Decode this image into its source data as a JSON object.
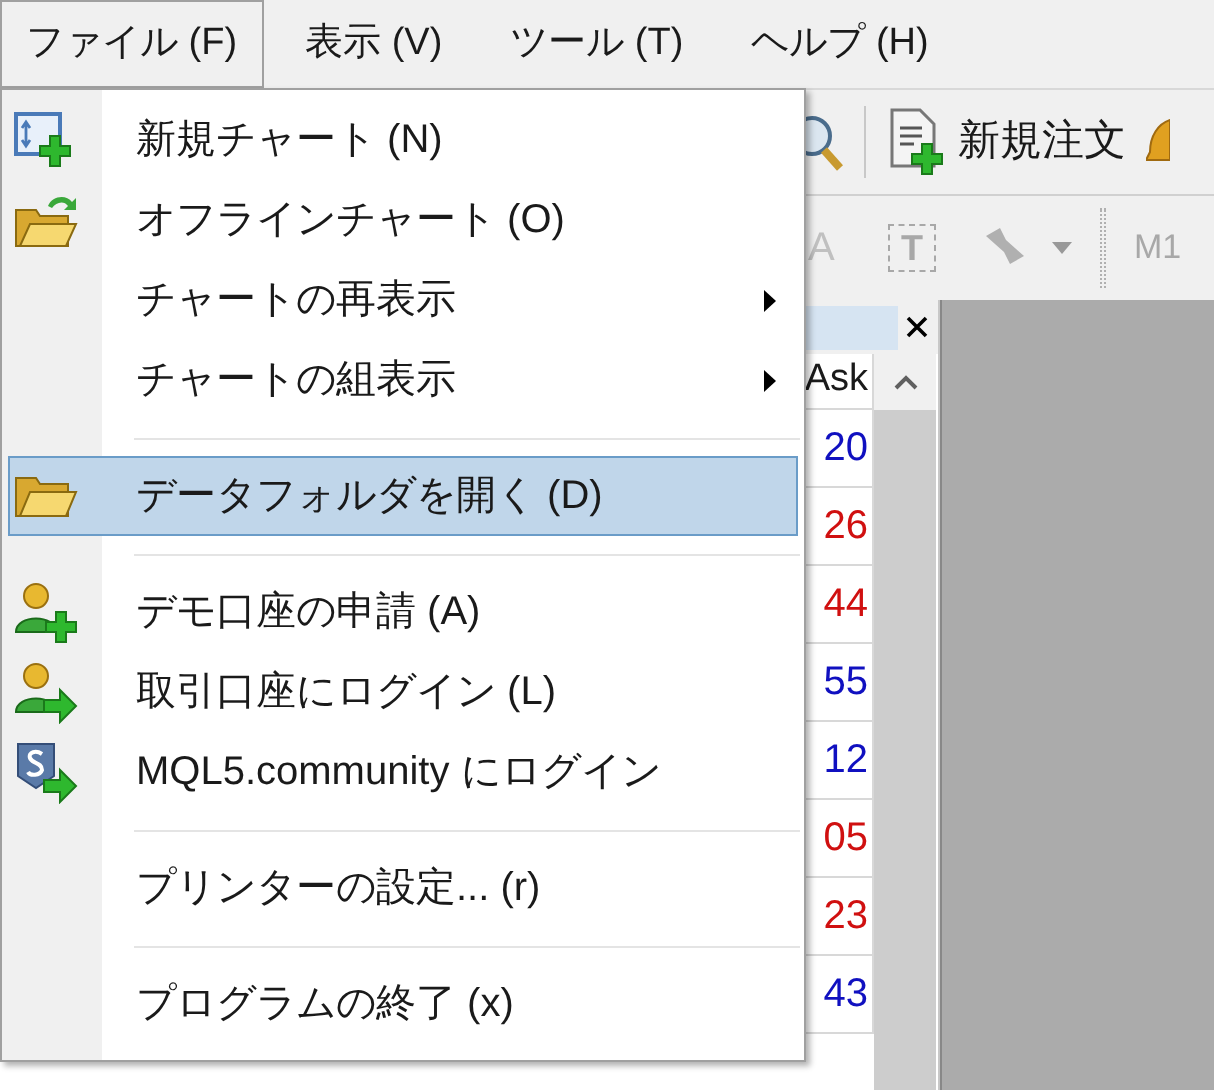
{
  "menubar": [
    {
      "label": "ファイル (F)",
      "selected": true
    },
    {
      "label": "表示 (V)",
      "selected": false
    },
    {
      "label": "ツール (T)",
      "selected": false
    },
    {
      "label": "ヘルプ (H)",
      "selected": false
    }
  ],
  "toolbar": {
    "new_order": "新規注文",
    "font_tool": "A",
    "text_tool": "T",
    "timeframe": "M1"
  },
  "market_watch": {
    "column": "Ask",
    "rows": [
      {
        "value": "20",
        "color": "#1010c0"
      },
      {
        "value": "26",
        "color": "#d01010"
      },
      {
        "value": "44",
        "color": "#d01010"
      },
      {
        "value": "55",
        "color": "#1010c0"
      },
      {
        "value": "12",
        "color": "#1010c0"
      },
      {
        "value": "05",
        "color": "#d01010"
      },
      {
        "value": "23",
        "color": "#d01010"
      },
      {
        "value": "43",
        "color": "#1010c0"
      }
    ]
  },
  "file_menu": [
    {
      "kind": "item",
      "label": "新規チャート (N)",
      "selected": false,
      "submenu": false
    },
    {
      "kind": "item",
      "label": "オフラインチャート (O)",
      "selected": false,
      "submenu": false
    },
    {
      "kind": "item",
      "label": "チャートの再表示",
      "selected": false,
      "submenu": true
    },
    {
      "kind": "item",
      "label": "チャートの組表示",
      "selected": false,
      "submenu": true
    },
    {
      "kind": "separator"
    },
    {
      "kind": "item",
      "label": "データフォルダを開く (D)",
      "selected": true,
      "submenu": false
    },
    {
      "kind": "separator"
    },
    {
      "kind": "item",
      "label": "デモ口座の申請 (A)",
      "selected": false,
      "submenu": false
    },
    {
      "kind": "item",
      "label": "取引口座にログイン (L)",
      "selected": false,
      "submenu": false
    },
    {
      "kind": "item",
      "label": "MQL5.community にログイン",
      "selected": false,
      "submenu": false
    },
    {
      "kind": "separator"
    },
    {
      "kind": "item",
      "label": "プリンターの設定... (r)",
      "selected": false,
      "submenu": false
    },
    {
      "kind": "separator"
    },
    {
      "kind": "item",
      "label": "プログラムの終了 (x)",
      "selected": false,
      "submenu": false
    }
  ]
}
